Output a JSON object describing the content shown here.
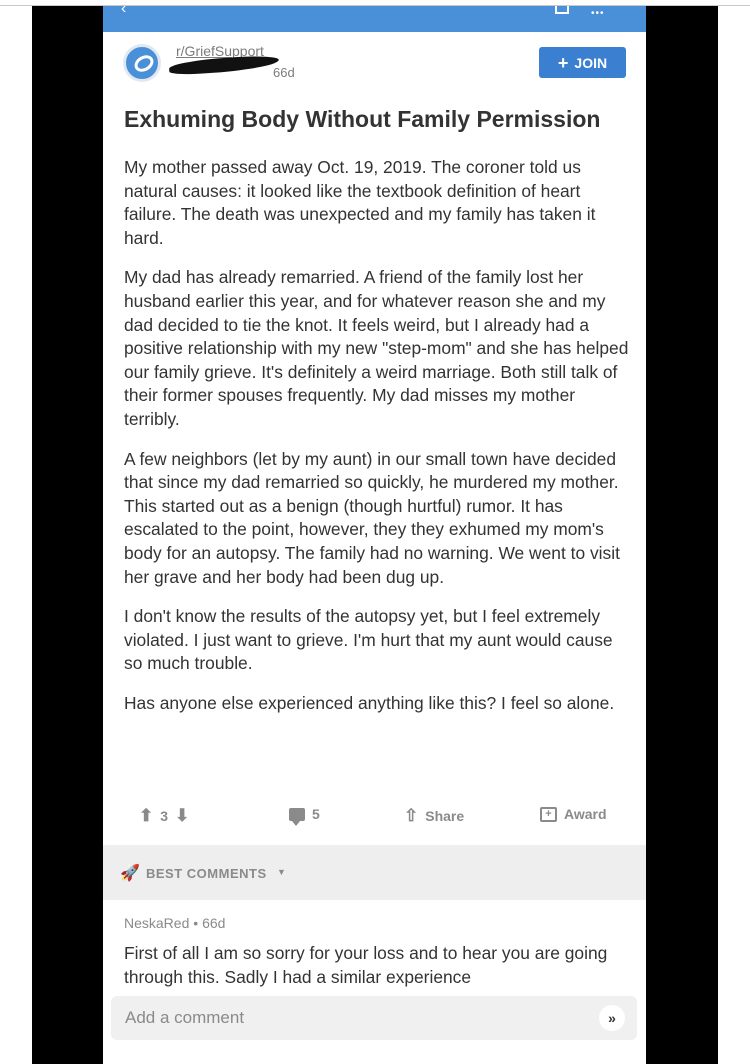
{
  "subreddit": {
    "name": "r/GriefSupport",
    "age": "66d",
    "join_label": "JOIN",
    "join_icon": "plus-icon"
  },
  "post": {
    "title": "Exhuming Body Without Family Permission",
    "paragraphs": [
      "My mother passed away Oct. 19, 2019.  The coroner told us natural causes:  it looked like the textbook definition of heart failure.  The death was unexpected and my family has taken it hard.",
      "My dad has already remarried.  A friend of the family lost her husband earlier this year, and for whatever reason she and my dad decided to tie the knot.  It feels weird, but I already had a positive relationship with my new \"step-mom\" and she has helped our family grieve.  It's definitely a weird marriage.  Both still talk of their former spouses frequently.  My dad misses my mother terribly.",
      "A few neighbors (let by my aunt) in our small town have decided that since my dad remarried so quickly, he murdered my mother.  This started out as a benign (though hurtful) rumor.  It has escalated to the point, however, they they exhumed my mom's body for an autopsy.  The family had no warning.  We went to visit her grave and her body had been dug up.",
      "I don't know the results of the autopsy yet, but I feel extremely violated.  I just want to grieve.  I'm hurt that my aunt would cause so much trouble.",
      "Has anyone else experienced anything like this?  I feel so alone."
    ]
  },
  "actions": {
    "score": "3",
    "comments": "5",
    "share_label": "Share",
    "award_label": "Award"
  },
  "comments_section": {
    "sort_label": "BEST COMMENTS",
    "first_comment": {
      "author": "NeskaRed",
      "age": "66d",
      "text": "First of all I am so sorry for your loss and to hear you are going through this. Sadly I had a similar experience"
    }
  },
  "composer": {
    "placeholder": "Add a comment"
  },
  "colors": {
    "accent": "#4a90d9",
    "join_button": "#3a7fd0",
    "text": "#333333",
    "muted": "#8a8a8a"
  }
}
